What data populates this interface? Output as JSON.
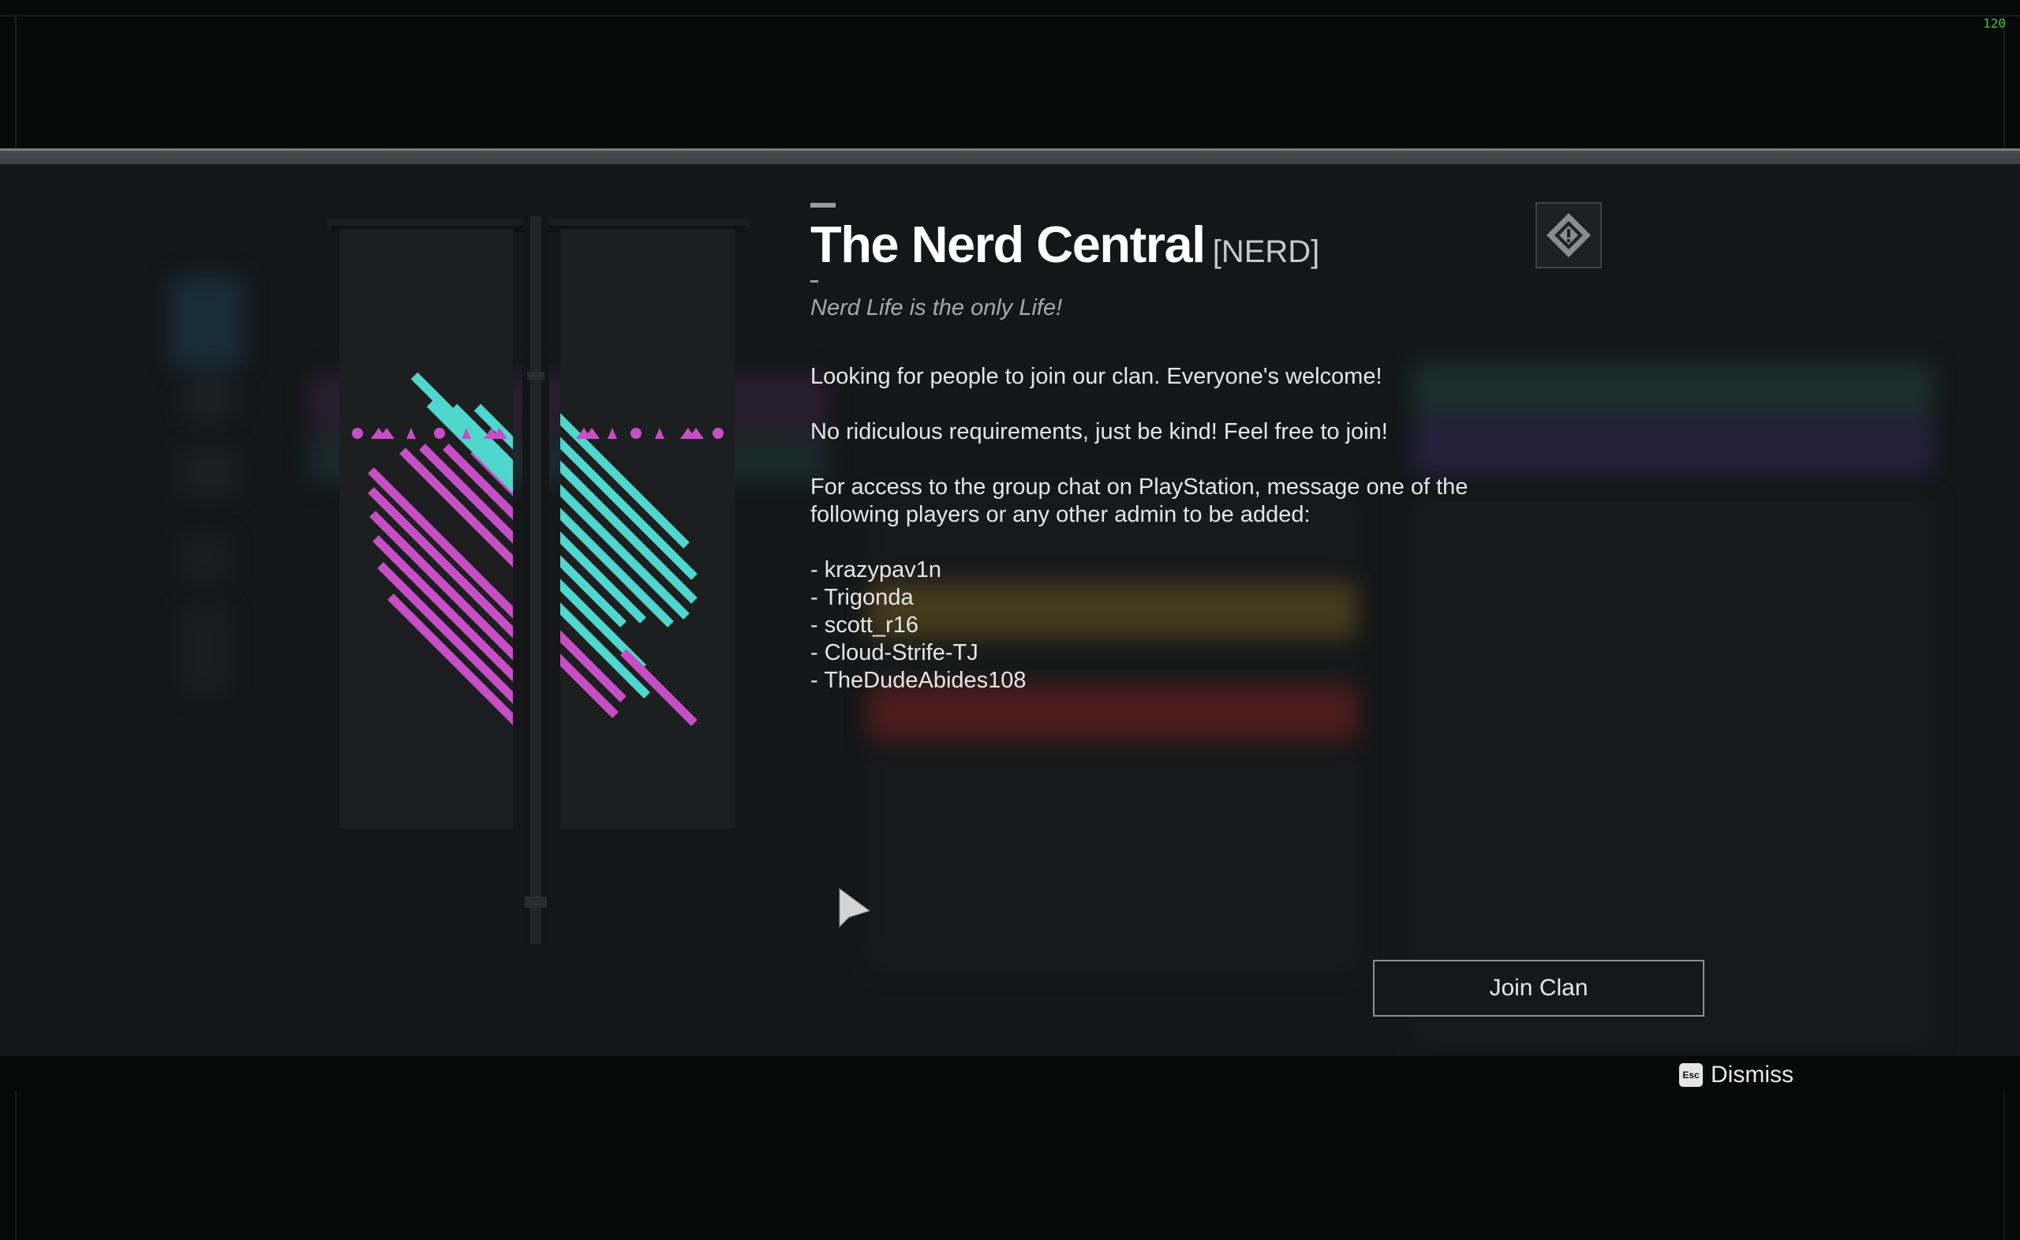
{
  "hud": {
    "fps": "120"
  },
  "clan": {
    "name": "The Nerd Central",
    "tag": "[NERD]",
    "motto": "Nerd Life is the only Life!",
    "description": [
      "Looking for people to join our clan. Everyone's welcome!",
      "No ridiculous requirements, just be kind! Feel free to join!",
      "For access to the group chat on PlayStation, message one of the following players or any other admin to be added:"
    ],
    "contacts": [
      "- krazypav1n",
      "- Trigonda",
      "- scott_r16",
      "- Cloud-Strife-TJ",
      "- TheDudeAbides108"
    ],
    "banner_colors": {
      "primary": "#c64fc6",
      "secondary": "#4fd6cd",
      "cloth": "#1d1e1f"
    }
  },
  "actions": {
    "join_label": "Join Clan",
    "dismiss_key": "Esc",
    "dismiss_label": "Dismiss"
  },
  "icons": {
    "emblem": "diamond-alert-icon",
    "cursor": "mouse-cursor-icon"
  }
}
